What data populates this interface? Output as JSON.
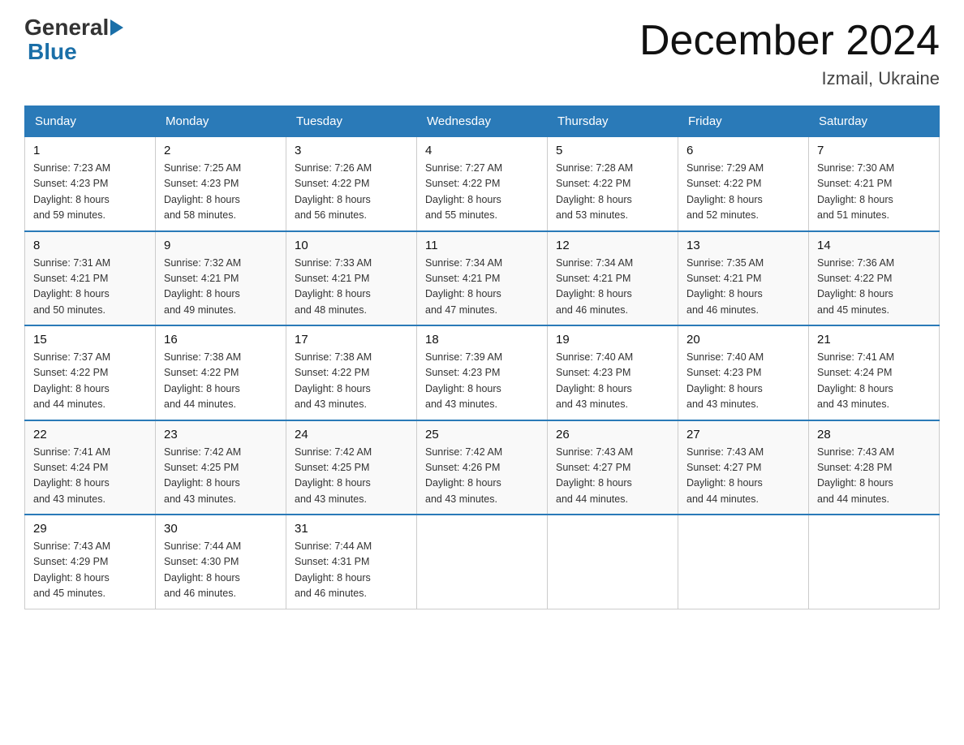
{
  "header": {
    "logo_general": "General",
    "logo_blue": "Blue",
    "month_title": "December 2024",
    "location": "Izmail, Ukraine"
  },
  "weekdays": [
    "Sunday",
    "Monday",
    "Tuesday",
    "Wednesday",
    "Thursday",
    "Friday",
    "Saturday"
  ],
  "weeks": [
    [
      {
        "day": "1",
        "sunrise": "7:23 AM",
        "sunset": "4:23 PM",
        "daylight": "8 hours and 59 minutes."
      },
      {
        "day": "2",
        "sunrise": "7:25 AM",
        "sunset": "4:23 PM",
        "daylight": "8 hours and 58 minutes."
      },
      {
        "day": "3",
        "sunrise": "7:26 AM",
        "sunset": "4:22 PM",
        "daylight": "8 hours and 56 minutes."
      },
      {
        "day": "4",
        "sunrise": "7:27 AM",
        "sunset": "4:22 PM",
        "daylight": "8 hours and 55 minutes."
      },
      {
        "day": "5",
        "sunrise": "7:28 AM",
        "sunset": "4:22 PM",
        "daylight": "8 hours and 53 minutes."
      },
      {
        "day": "6",
        "sunrise": "7:29 AM",
        "sunset": "4:22 PM",
        "daylight": "8 hours and 52 minutes."
      },
      {
        "day": "7",
        "sunrise": "7:30 AM",
        "sunset": "4:21 PM",
        "daylight": "8 hours and 51 minutes."
      }
    ],
    [
      {
        "day": "8",
        "sunrise": "7:31 AM",
        "sunset": "4:21 PM",
        "daylight": "8 hours and 50 minutes."
      },
      {
        "day": "9",
        "sunrise": "7:32 AM",
        "sunset": "4:21 PM",
        "daylight": "8 hours and 49 minutes."
      },
      {
        "day": "10",
        "sunrise": "7:33 AM",
        "sunset": "4:21 PM",
        "daylight": "8 hours and 48 minutes."
      },
      {
        "day": "11",
        "sunrise": "7:34 AM",
        "sunset": "4:21 PM",
        "daylight": "8 hours and 47 minutes."
      },
      {
        "day": "12",
        "sunrise": "7:34 AM",
        "sunset": "4:21 PM",
        "daylight": "8 hours and 46 minutes."
      },
      {
        "day": "13",
        "sunrise": "7:35 AM",
        "sunset": "4:21 PM",
        "daylight": "8 hours and 46 minutes."
      },
      {
        "day": "14",
        "sunrise": "7:36 AM",
        "sunset": "4:22 PM",
        "daylight": "8 hours and 45 minutes."
      }
    ],
    [
      {
        "day": "15",
        "sunrise": "7:37 AM",
        "sunset": "4:22 PM",
        "daylight": "8 hours and 44 minutes."
      },
      {
        "day": "16",
        "sunrise": "7:38 AM",
        "sunset": "4:22 PM",
        "daylight": "8 hours and 44 minutes."
      },
      {
        "day": "17",
        "sunrise": "7:38 AM",
        "sunset": "4:22 PM",
        "daylight": "8 hours and 43 minutes."
      },
      {
        "day": "18",
        "sunrise": "7:39 AM",
        "sunset": "4:23 PM",
        "daylight": "8 hours and 43 minutes."
      },
      {
        "day": "19",
        "sunrise": "7:40 AM",
        "sunset": "4:23 PM",
        "daylight": "8 hours and 43 minutes."
      },
      {
        "day": "20",
        "sunrise": "7:40 AM",
        "sunset": "4:23 PM",
        "daylight": "8 hours and 43 minutes."
      },
      {
        "day": "21",
        "sunrise": "7:41 AM",
        "sunset": "4:24 PM",
        "daylight": "8 hours and 43 minutes."
      }
    ],
    [
      {
        "day": "22",
        "sunrise": "7:41 AM",
        "sunset": "4:24 PM",
        "daylight": "8 hours and 43 minutes."
      },
      {
        "day": "23",
        "sunrise": "7:42 AM",
        "sunset": "4:25 PM",
        "daylight": "8 hours and 43 minutes."
      },
      {
        "day": "24",
        "sunrise": "7:42 AM",
        "sunset": "4:25 PM",
        "daylight": "8 hours and 43 minutes."
      },
      {
        "day": "25",
        "sunrise": "7:42 AM",
        "sunset": "4:26 PM",
        "daylight": "8 hours and 43 minutes."
      },
      {
        "day": "26",
        "sunrise": "7:43 AM",
        "sunset": "4:27 PM",
        "daylight": "8 hours and 44 minutes."
      },
      {
        "day": "27",
        "sunrise": "7:43 AM",
        "sunset": "4:27 PM",
        "daylight": "8 hours and 44 minutes."
      },
      {
        "day": "28",
        "sunrise": "7:43 AM",
        "sunset": "4:28 PM",
        "daylight": "8 hours and 44 minutes."
      }
    ],
    [
      {
        "day": "29",
        "sunrise": "7:43 AM",
        "sunset": "4:29 PM",
        "daylight": "8 hours and 45 minutes."
      },
      {
        "day": "30",
        "sunrise": "7:44 AM",
        "sunset": "4:30 PM",
        "daylight": "8 hours and 46 minutes."
      },
      {
        "day": "31",
        "sunrise": "7:44 AM",
        "sunset": "4:31 PM",
        "daylight": "8 hours and 46 minutes."
      },
      null,
      null,
      null,
      null
    ]
  ],
  "labels": {
    "sunrise": "Sunrise:",
    "sunset": "Sunset:",
    "daylight": "Daylight:"
  }
}
